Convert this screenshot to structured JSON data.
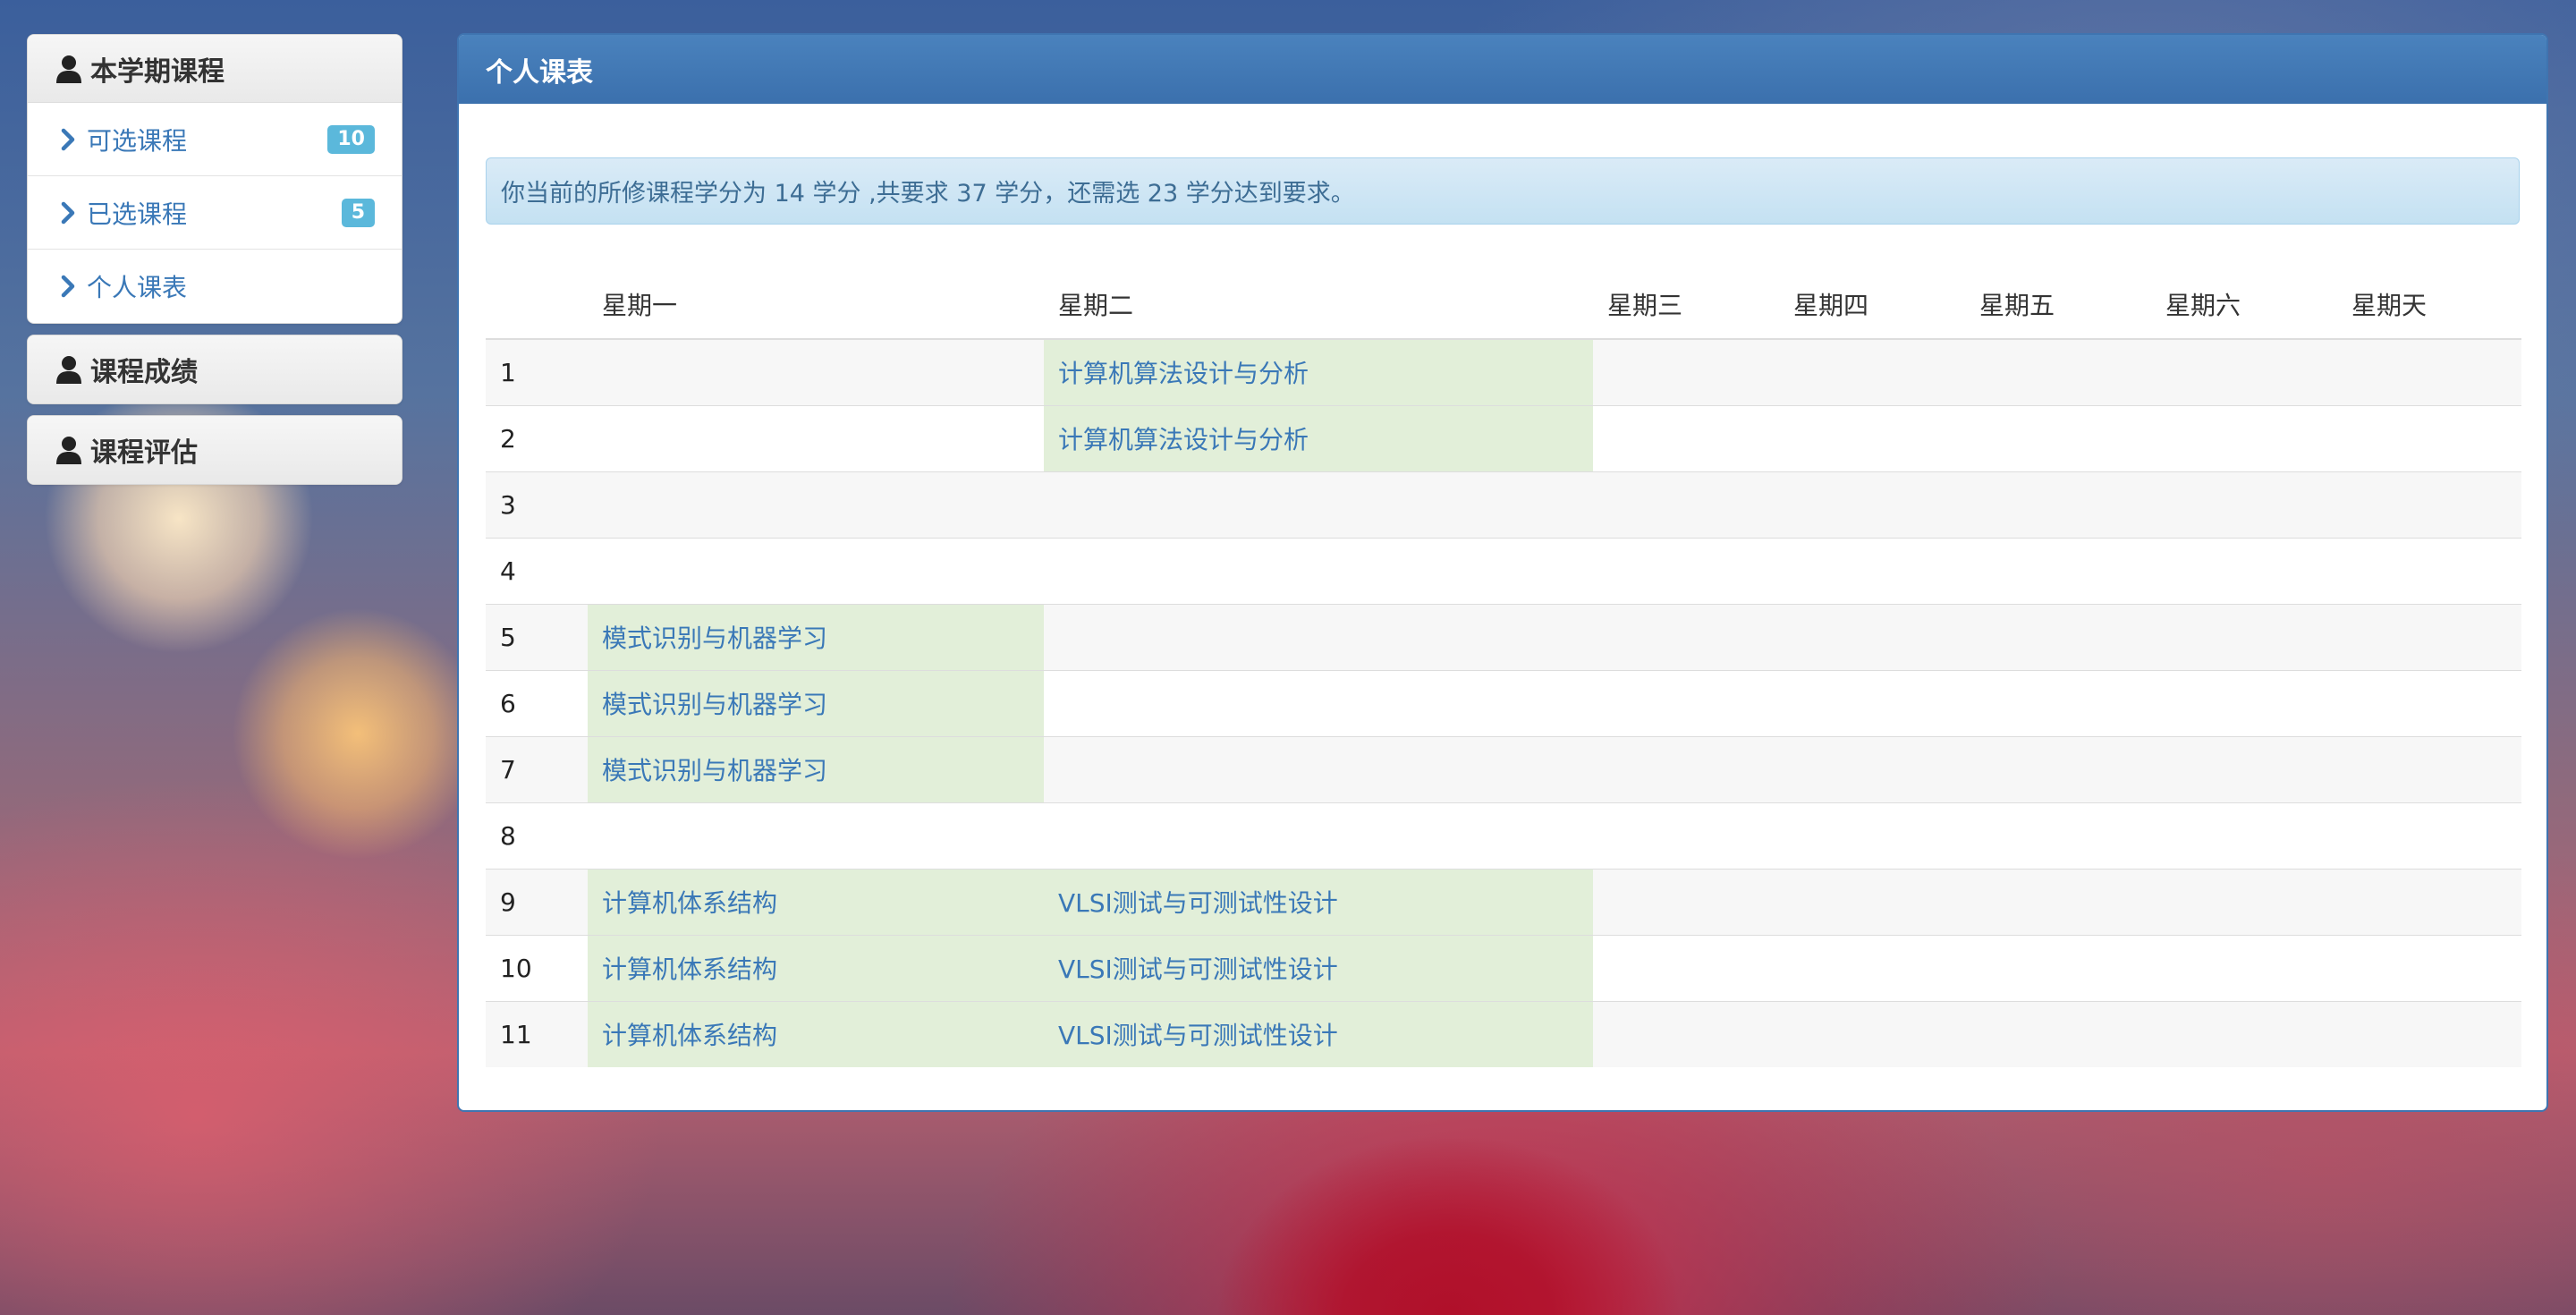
{
  "sidebar": {
    "semester_courses": {
      "title": "本学期课程",
      "items": [
        {
          "label": "可选课程",
          "badge": "10"
        },
        {
          "label": "已选课程",
          "badge": "5"
        },
        {
          "label": "个人课表",
          "badge": null
        }
      ]
    },
    "grades": {
      "title": "课程成绩"
    },
    "evaluation": {
      "title": "课程评估"
    }
  },
  "main": {
    "title": "个人课表",
    "alert": "你当前的所修课程学分为 14 学分 ,共要求 37 学分，还需选 23 学分达到要求。",
    "columns": [
      "",
      "星期一",
      "星期二",
      "星期三",
      "星期四",
      "星期五",
      "星期六",
      "星期天"
    ],
    "rows": [
      {
        "num": "1",
        "cells": [
          "",
          "计算机算法设计与分析",
          "",
          "",
          "",
          "",
          ""
        ]
      },
      {
        "num": "2",
        "cells": [
          "",
          "计算机算法设计与分析",
          "",
          "",
          "",
          "",
          ""
        ]
      },
      {
        "num": "3",
        "cells": [
          "",
          "",
          "",
          "",
          "",
          "",
          ""
        ]
      },
      {
        "num": "4",
        "cells": [
          "",
          "",
          "",
          "",
          "",
          "",
          ""
        ]
      },
      {
        "num": "5",
        "cells": [
          "模式识别与机器学习",
          "",
          "",
          "",
          "",
          "",
          ""
        ]
      },
      {
        "num": "6",
        "cells": [
          "模式识别与机器学习",
          "",
          "",
          "",
          "",
          "",
          ""
        ]
      },
      {
        "num": "7",
        "cells": [
          "模式识别与机器学习",
          "",
          "",
          "",
          "",
          "",
          ""
        ]
      },
      {
        "num": "8",
        "cells": [
          "",
          "",
          "",
          "",
          "",
          "",
          ""
        ]
      },
      {
        "num": "9",
        "cells": [
          "计算机体系结构",
          "VLSI测试与可测试性设计",
          "",
          "",
          "",
          "",
          ""
        ]
      },
      {
        "num": "10",
        "cells": [
          "计算机体系结构",
          "VLSI测试与可测试性设计",
          "",
          "",
          "",
          "",
          ""
        ]
      },
      {
        "num": "11",
        "cells": [
          "计算机体系结构",
          "VLSI测试与可测试性设计",
          "",
          "",
          "",
          "",
          ""
        ]
      }
    ]
  },
  "colors": {
    "primary": "#3b70ad",
    "link": "#3a78b7",
    "badge": "#5bb8db",
    "course_cell": "#e2efd9",
    "alert_bg": "#d1e7f5"
  },
  "icons": [
    "user-icon",
    "chevron-right-icon"
  ]
}
